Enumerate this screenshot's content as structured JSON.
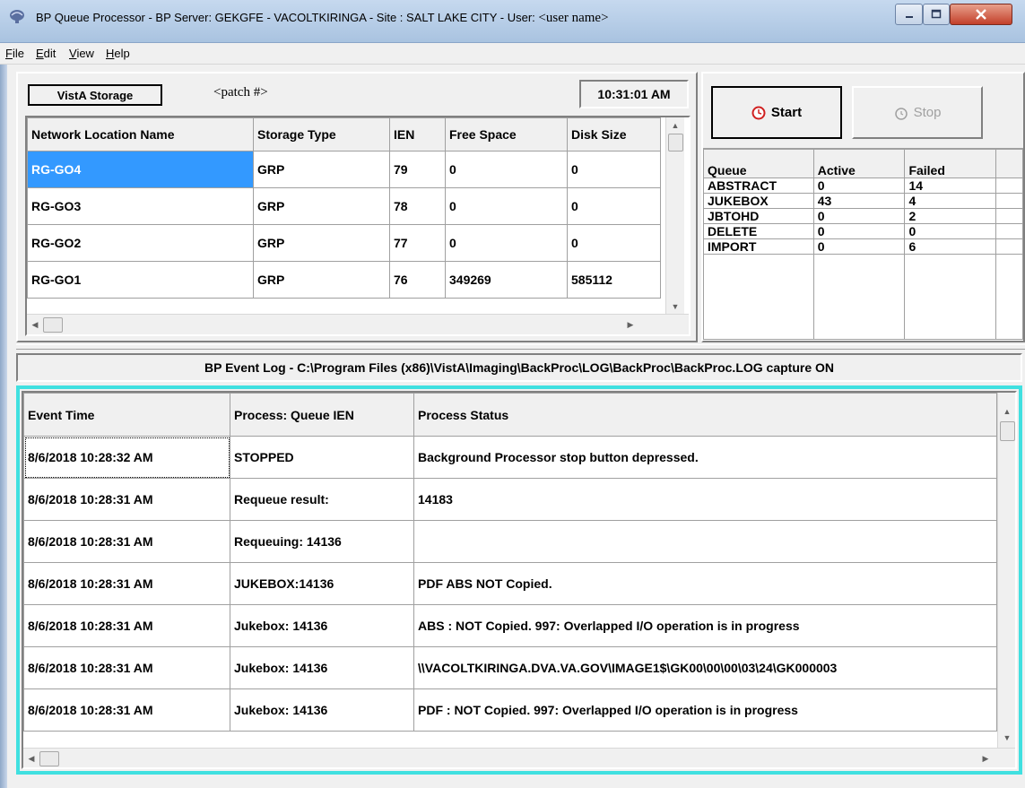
{
  "window": {
    "title_main": "BP Queue Processor   -  BP Server: GEKGFE - VACOLTKIRINGA  - Site : SALT LAKE CITY  -  User:",
    "user_name": "<user name>"
  },
  "menu": [
    {
      "label": "File",
      "u": "F",
      "rest": "ile"
    },
    {
      "label": "Edit",
      "u": "E",
      "rest": "dit"
    },
    {
      "label": "View",
      "u": "V",
      "rest": "iew"
    },
    {
      "label": "Help",
      "u": "H",
      "rest": "elp"
    }
  ],
  "storage": {
    "mode_button": "VistA Storage",
    "patch": "<patch #>",
    "clock": "10:31:01 AM",
    "columns": [
      "Network Location Name",
      "Storage Type",
      "IEN",
      "Free Space",
      "Disk Size"
    ],
    "rows": [
      [
        "RG-GO4",
        "GRP",
        "79",
        "0",
        "0"
      ],
      [
        "RG-GO3",
        "GRP",
        "78",
        "0",
        "0"
      ],
      [
        "RG-GO2",
        "GRP",
        "77",
        "0",
        "0"
      ],
      [
        "RG-GO1",
        "GRP",
        "76",
        "349269",
        "585112"
      ]
    ]
  },
  "controls": {
    "start_label": "Start",
    "stop_label": "Stop"
  },
  "queue": {
    "columns": [
      "Queue",
      "Active",
      "Failed"
    ],
    "rows": [
      [
        "ABSTRACT",
        "0",
        "14"
      ],
      [
        "JUKEBOX",
        "43",
        "4"
      ],
      [
        "JBTOHD",
        "0",
        "2"
      ],
      [
        "DELETE",
        "0",
        "0"
      ],
      [
        "IMPORT",
        "0",
        "6"
      ]
    ]
  },
  "event_log": {
    "header": "BP Event Log - C:\\Program Files (x86)\\VistA\\Imaging\\BackProc\\LOG\\BackProc\\BackProc.LOG capture ON",
    "columns": [
      "Event Time",
      "Process: Queue IEN",
      "Process Status"
    ],
    "rows": [
      [
        "8/6/2018 10:28:32 AM",
        "STOPPED",
        " Background Processor stop button depressed."
      ],
      [
        "8/6/2018 10:28:31 AM",
        "Requeue result:",
        " 14183"
      ],
      [
        "8/6/2018 10:28:31 AM",
        "Requeuing: 14136",
        ""
      ],
      [
        "8/6/2018 10:28:31 AM",
        "JUKEBOX:14136",
        "PDF ABS NOT Copied."
      ],
      [
        "8/6/2018 10:28:31 AM",
        "Jukebox: 14136",
        "ABS : NOT Copied. 997: Overlapped I/O operation is in progress"
      ],
      [
        "8/6/2018 10:28:31 AM",
        "Jukebox: 14136",
        "\\\\VACOLTKIRINGA.DVA.VA.GOV\\IMAGE1$\\GK00\\00\\00\\03\\24\\GK000003"
      ],
      [
        "8/6/2018 10:28:31 AM",
        "Jukebox: 14136",
        "PDF : NOT Copied. 997: Overlapped I/O operation is in progress"
      ]
    ]
  },
  "colors": {
    "selection": "#3399ff",
    "log_border": "#40e0e0",
    "title_gradient": "#c6d9ef"
  }
}
